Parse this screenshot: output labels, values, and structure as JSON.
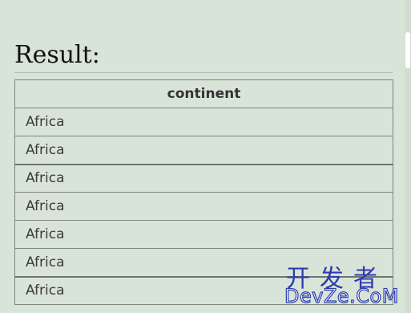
{
  "heading": "Result:",
  "table": {
    "header": "continent",
    "rows": [
      "Africa",
      "Africa",
      "Africa",
      "Africa",
      "Africa",
      "Africa",
      "Africa"
    ]
  },
  "watermark": {
    "line1": "开发者",
    "line2": "DevZe.CoM"
  },
  "colors": {
    "background": "#d9e4d8",
    "watermark": "#2b3cae"
  }
}
